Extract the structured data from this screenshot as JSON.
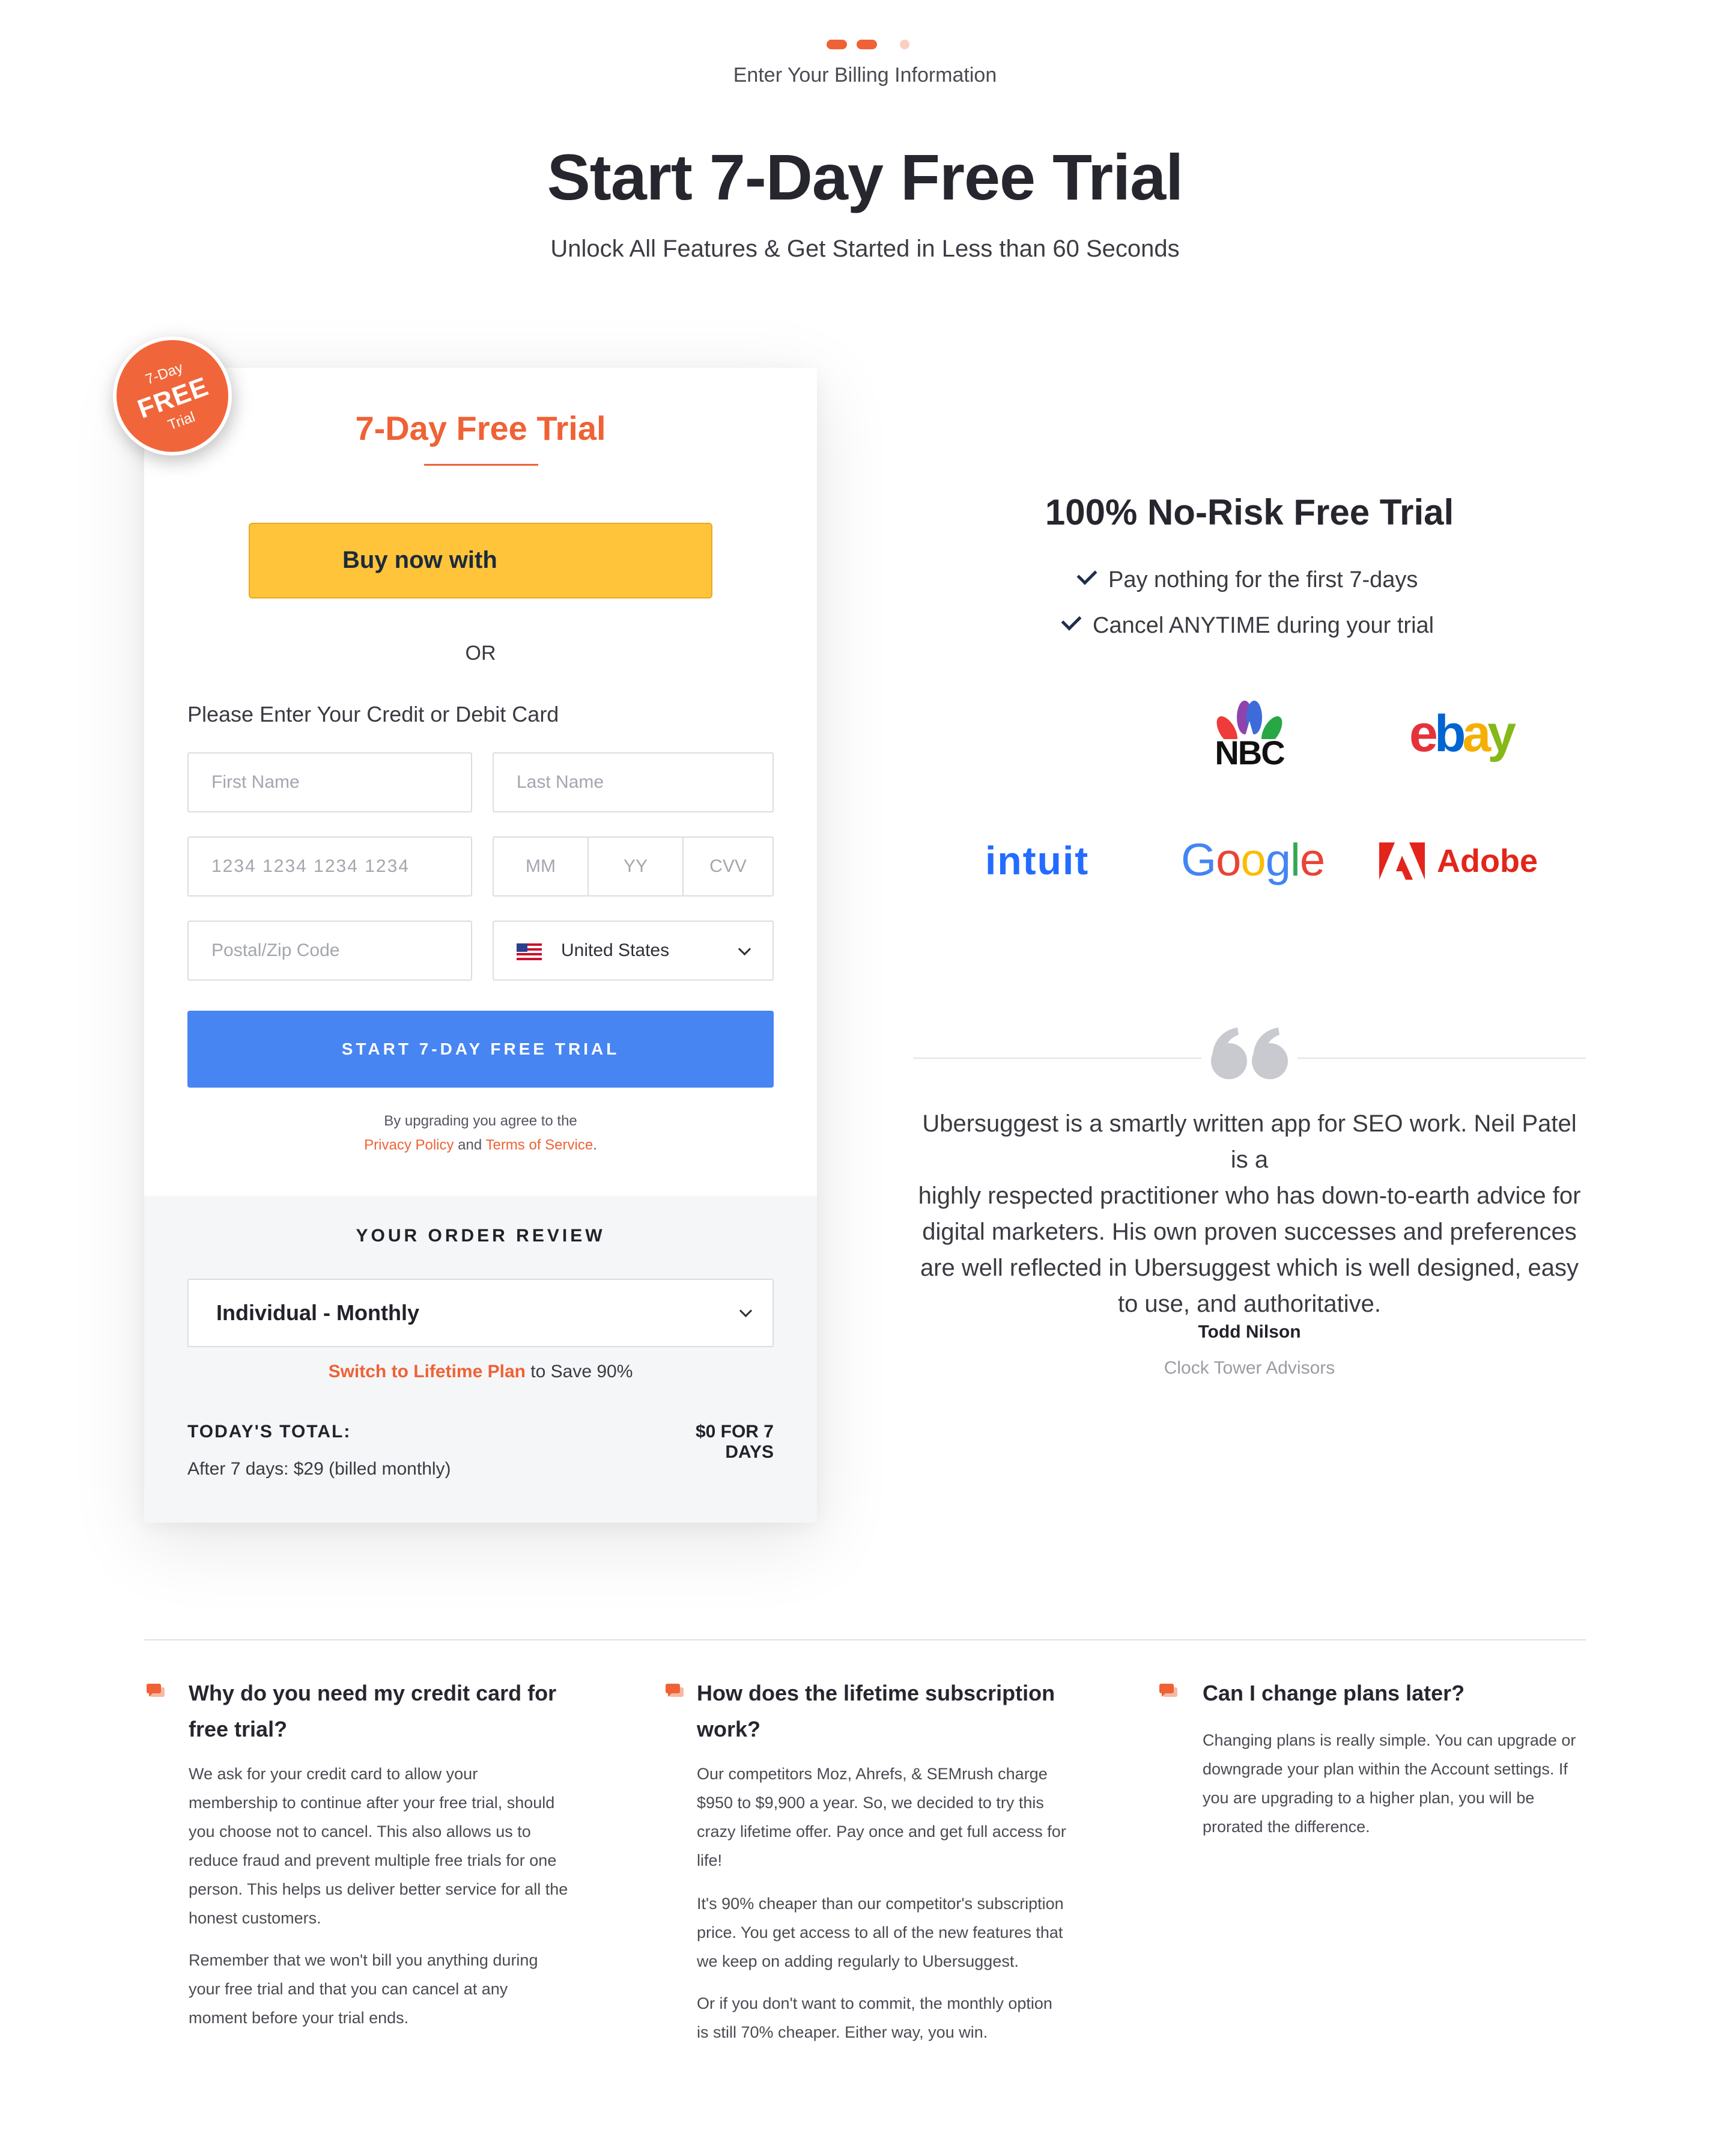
{
  "progress": {
    "step_label": "Enter Your Billing Information",
    "dots": [
      "active",
      "active",
      "inactive"
    ]
  },
  "hero": {
    "title": "Start 7-Day Free Trial",
    "subtitle": "Unlock All Features & Get Started in Less than 60 Seconds"
  },
  "badge": {
    "line1": "7-Day",
    "line2": "FREE",
    "line3": "Trial"
  },
  "form": {
    "card_title": "7-Day Free Trial",
    "paypal_button_label": "Buy now with",
    "or_label": "OR",
    "card_prompt": "Please Enter Your Credit or Debit Card",
    "first_name_placeholder": "First Name",
    "last_name_placeholder": "Last Name",
    "card_number_placeholder": "1234 1234 1234 1234",
    "month_placeholder": "MM",
    "year_placeholder": "YY",
    "cvv_placeholder": "CVV",
    "postal_placeholder": "Postal/Zip Code",
    "country_value": "United States",
    "submit_label": "START 7-DAY FREE TRIAL",
    "legal_line1": "By upgrading you agree to the",
    "privacy_link": "Privacy Policy",
    "legal_and": " and ",
    "terms_link": "Terms of Service",
    "legal_period": "."
  },
  "order": {
    "title": "YOUR ORDER REVIEW",
    "plan_value": "Individual - Monthly",
    "switch_link": "Switch to Lifetime Plan",
    "switch_suffix": " to Save 90%",
    "total_label": "TODAY'S TOTAL:",
    "total_value": "$0 FOR 7 DAYS",
    "after_note": "After 7 days: $29 (billed monthly)"
  },
  "no_risk": {
    "title": "100% No-Risk Free Trial",
    "points": [
      "Pay nothing for the first 7-days",
      "Cancel ANYTIME during your trial"
    ]
  },
  "logos": {
    "nbc": "NBC",
    "ebay": "ebay",
    "intuit": "intuit",
    "google": "Google",
    "adobe": "Adobe"
  },
  "testimonial": {
    "lines": [
      "Ubersuggest is a smartly written app for SEO work. Neil Patel is a",
      "highly respected practitioner who has down-to-earth advice for",
      "digital marketers. His own proven successes and preferences",
      "are well reflected in Ubersuggest which is well designed, easy",
      "to use, and authoritative."
    ],
    "author": "Todd Nilson",
    "company": "Clock Tower Advisors"
  },
  "faq": [
    {
      "question_lines": [
        "Why do you need my credit card for",
        "free trial?"
      ],
      "paragraph_lines": [
        [
          "We ask for your credit card to allow your",
          "membership to continue after your free trial, should",
          "you choose not to cancel. This also allows us to",
          "reduce fraud and prevent multiple free trials for one",
          "person. This helps us deliver better service for all the",
          "honest customers."
        ],
        [
          "Remember that we won't bill you anything during",
          "your free trial and that you can cancel at any",
          "moment before your trial ends."
        ]
      ]
    },
    {
      "question_lines": [
        "How does the lifetime subscription",
        "work?"
      ],
      "paragraph_lines": [
        [
          "Our competitors Moz, Ahrefs, & SEMrush charge",
          "$950 to $9,900 a year. So, we decided to try this",
          "crazy lifetime offer. Pay once and get full access for",
          "life!"
        ],
        [
          "It's 90% cheaper than our competitor's subscription",
          "price. You get access to all of the new features that",
          "we keep on adding regularly to Ubersuggest."
        ],
        [
          "Or if you don't want to commit, the monthly option",
          "is still 70% cheaper. Either way, you win."
        ]
      ]
    },
    {
      "question_lines": [
        "Can I change plans later?"
      ],
      "paragraph_lines": [
        [
          "Changing plans is really simple. You can upgrade or",
          "downgrade your plan within the Account settings. If",
          "you are upgrading to a higher plan, you will be",
          "prorated the difference."
        ]
      ]
    }
  ],
  "colors": {
    "accent": "#ef6235",
    "paypal_yellow": "#ffc43a",
    "primary_blue": "#4785f2",
    "dot_inactive": "#f9cfc2"
  }
}
